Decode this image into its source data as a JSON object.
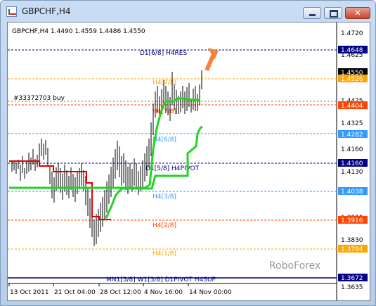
{
  "window": {
    "title": "GBPCHF,H4"
  },
  "chart_header": "GBPCHF,H4  1.4490 1.4559 1.4486 1.4550",
  "order_label": "#33372703 buy",
  "watermark": "RoboForex",
  "colors": {
    "green_line": "#22d322",
    "red_line": "#e00000",
    "arrow": "#f5843a",
    "navy": "#000080"
  },
  "price_axis": {
    "ticks": [
      "1.4720",
      "1.4625",
      "1.4425",
      "1.4325",
      "1.4160",
      "1.4130",
      "1.3920",
      "1.3830",
      "1.3635"
    ],
    "boxes": [
      {
        "label": "1.4648",
        "bg": "#000080",
        "fg": "#ffffff"
      },
      {
        "label": "1.4550",
        "bg": "#000000",
        "fg": "#ffffff"
      },
      {
        "label": "1.4526",
        "bg": "#ffa500",
        "fg": "#ffffff"
      },
      {
        "label": "1.4404",
        "bg": "#ff4500",
        "fg": "#ffffff"
      },
      {
        "label": "1.4282",
        "bg": "#3399ff",
        "fg": "#ffffff"
      },
      {
        "label": "1.4160",
        "bg": "#000080",
        "fg": "#ffffff"
      },
      {
        "label": "1.4038",
        "bg": "#3399ff",
        "fg": "#ffffff"
      },
      {
        "label": "1.3916",
        "bg": "#ff4500",
        "fg": "#ffffff"
      },
      {
        "label": "1.3794",
        "bg": "#ffa500",
        "fg": "#ffffff"
      },
      {
        "label": "1.3672",
        "bg": "#000080",
        "fg": "#ffffff"
      }
    ]
  },
  "levels": [
    {
      "label": "D1[6/8] H4RES",
      "color": "#000080"
    },
    {
      "label": "H4[7/8]",
      "color": "#ffa500"
    },
    {
      "label": "H4[7/8]",
      "color": "#ff4500"
    },
    {
      "label": "H4[6/8]",
      "color": "#3399ff"
    },
    {
      "label": "D1[5/8] H4PIVOT",
      "color": "#000080"
    },
    {
      "label": "H4[3/8]",
      "color": "#3399ff"
    },
    {
      "label": "H4[2/8]",
      "color": "#ff4500"
    },
    {
      "label": "H4[1/8]",
      "color": "#ffa500"
    },
    {
      "label": "MN1[3/8] W1[3/8] D1PIVOT H4SUP",
      "color": "#000080"
    }
  ],
  "time_axis": [
    "13 Oct 2011",
    "21 Oct 04:00",
    "28 Oct 12:00",
    "4 Nov 16:00",
    "14 Nov 00:00"
  ]
}
